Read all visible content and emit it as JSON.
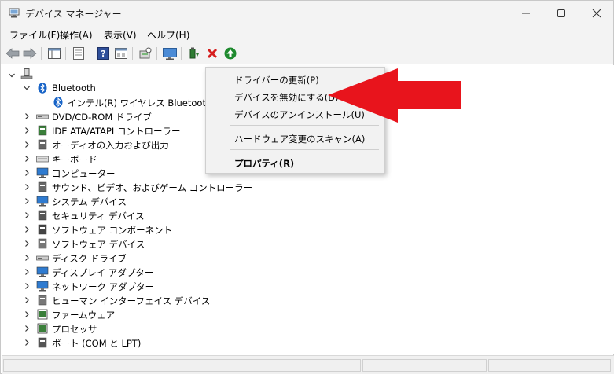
{
  "window": {
    "title": "デバイス マネージャー",
    "icon": "device-manager-icon",
    "controls": [
      "minimize-icon",
      "maximize-icon",
      "close-icon"
    ]
  },
  "menubar": {
    "items": [
      "ファイル(F)",
      "操作(A)",
      "表示(V)",
      "ヘルプ(H)"
    ]
  },
  "toolbar": {
    "buttons": [
      "back-arrow-icon",
      "forward-arrow-icon",
      "show-hide-console-tree-icon",
      "properties-icon",
      "help-icon",
      "view-icon",
      "scan-hardware-icon",
      "monitor-icon",
      "update-driver-icon",
      "uninstall-icon",
      "enable-device-icon"
    ]
  },
  "tree": {
    "root_label": "",
    "items": [
      {
        "label": "Bluetooth",
        "expanded": true,
        "icon": "bluetooth-icon"
      },
      {
        "label": "インテル(R) ワイヤレス Bluetooth(R)",
        "child": true,
        "icon": "bluetooth-icon"
      },
      {
        "label": "DVD/CD-ROM ドライブ",
        "icon": "dvd-drive-icon"
      },
      {
        "label": "IDE ATA/ATAPI コントローラー",
        "icon": "ide-controller-icon"
      },
      {
        "label": "オーディオの入力および出力",
        "icon": "audio-icon"
      },
      {
        "label": "キーボード",
        "icon": "keyboard-icon"
      },
      {
        "label": "コンピューター",
        "icon": "computer-icon"
      },
      {
        "label": "サウンド、ビデオ、およびゲーム コントローラー",
        "icon": "sound-icon"
      },
      {
        "label": "システム デバイス",
        "icon": "system-device-icon"
      },
      {
        "label": "セキュリティ デバイス",
        "icon": "security-device-icon"
      },
      {
        "label": "ソフトウェア コンポーネント",
        "icon": "software-component-icon"
      },
      {
        "label": "ソフトウェア デバイス",
        "icon": "software-device-icon"
      },
      {
        "label": "ディスク ドライブ",
        "icon": "disk-drive-icon"
      },
      {
        "label": "ディスプレイ アダプター",
        "icon": "display-adapter-icon"
      },
      {
        "label": "ネットワーク アダプター",
        "icon": "network-adapter-icon"
      },
      {
        "label": "ヒューマン インターフェイス デバイス",
        "icon": "hid-icon"
      },
      {
        "label": "ファームウェア",
        "icon": "firmware-icon"
      },
      {
        "label": "プロセッサ",
        "icon": "processor-icon"
      },
      {
        "label": "ポート (COM と LPT)",
        "icon": "port-icon"
      }
    ]
  },
  "context_menu": {
    "items": [
      {
        "label": "ドライバーの更新(P)"
      },
      {
        "label": "デバイスを無効にする(D)"
      },
      {
        "label": "デバイスのアンインストール(U)"
      },
      {
        "label": "ハードウェア変更のスキャン(A)"
      },
      {
        "label": "プロパティ(R)",
        "bold": true
      }
    ]
  },
  "annotation": {
    "icon": "red-arrow-pointer",
    "color": "#e8141c"
  },
  "colors": {
    "accent_blue": "#0067c0",
    "arrow_red": "#e8141c",
    "chrome": "#f3f3f3"
  }
}
